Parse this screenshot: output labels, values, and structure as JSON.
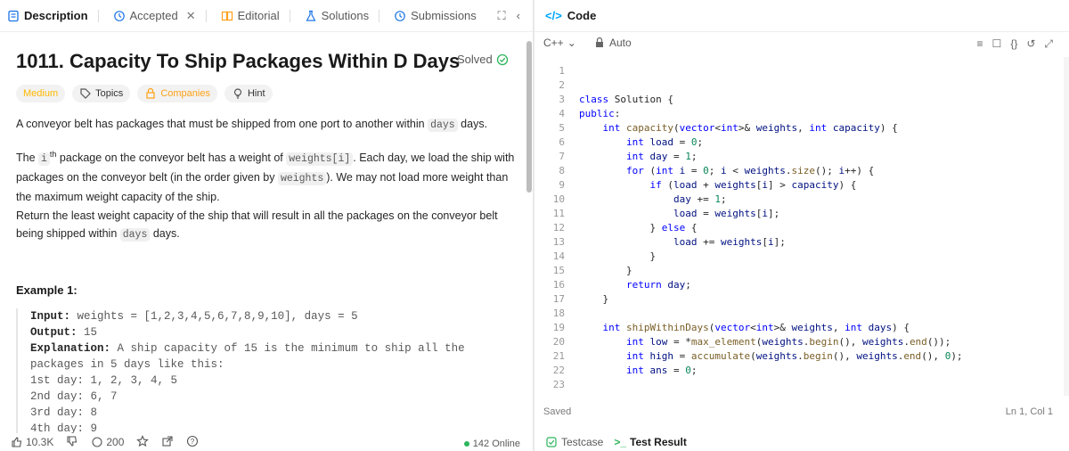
{
  "tabs": {
    "description": "Description",
    "accepted": "Accepted",
    "editorial": "Editorial",
    "solutions": "Solutions",
    "submissions": "Submissions"
  },
  "problem": {
    "title": "1011. Capacity To Ship Packages Within D Days",
    "solved": "Solved",
    "tags": {
      "difficulty": "Medium",
      "topics": "Topics",
      "companies": "Companies",
      "hint": "Hint"
    },
    "p1a": "A conveyor belt has packages that must be shipped from one port to another within ",
    "p1code": "days",
    "p1b": " days.",
    "p2a": "The ",
    "p2i": "i",
    "p2sup": "th",
    "p2b": " package on the conveyor belt has a weight of ",
    "p2code": "weights[i]",
    "p2c": ". Each day, we load the ship with packages on the conveyor belt (in the order given by ",
    "p2code2": "weights",
    "p2d": "). We may not load more weight than the maximum weight capacity of the ship.",
    "p3a": "Return the least weight capacity of the ship that will result in all the packages on the conveyor belt being shipped within ",
    "p3code": "days",
    "p3b": " days.",
    "example_title": "Example 1:",
    "example": {
      "input_label": "Input:",
      "input": "weights = [1,2,3,4,5,6,7,8,9,10], days = 5",
      "output_label": "Output:",
      "output": "15",
      "expl_label": "Explanation:",
      "expl": "A ship capacity of 15 is the minimum to ship all the packages in 5 days like this:",
      "d1": "1st day: 1, 2, 3, 4, 5",
      "d2": "2nd day: 6, 7",
      "d3": "3rd day: 8",
      "d4": "4th day: 9"
    }
  },
  "footer": {
    "likes": "10.3K",
    "comments": "200",
    "online": "142 Online"
  },
  "code_panel": {
    "title": "Code",
    "lang": "C++",
    "auto": "Auto",
    "status": "Saved",
    "cursor": "Ln 1, Col 1",
    "tab_testcase": "Testcase",
    "tab_result": "Test Result",
    "line_numbers": [
      "1",
      "2",
      "3",
      "4",
      "5",
      "6",
      "7",
      "8",
      "9",
      "10",
      "11",
      "12",
      "13",
      "14",
      "15",
      "16",
      "17",
      "18",
      "19",
      "20",
      "21",
      "22",
      "23"
    ]
  }
}
